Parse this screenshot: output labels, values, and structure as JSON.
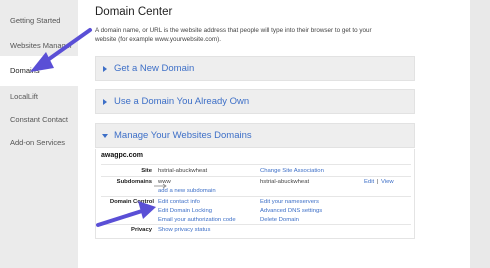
{
  "sidebar": {
    "items": [
      {
        "label": "Getting Started"
      },
      {
        "label": "Websites Manager"
      },
      {
        "label": "Domains"
      },
      {
        "label": "LocalLift"
      },
      {
        "label": "Constant Contact"
      },
      {
        "label": "Add-on Services"
      }
    ]
  },
  "main": {
    "title": "Domain Center",
    "intro": "A domain name, or URL is the website address that people will type into their browser to get to your website (for example www.yourwebsite.com).",
    "accordions": [
      {
        "label": "Get a New Domain"
      },
      {
        "label": "Use a Domain You Already Own"
      },
      {
        "label": "Manage Your Websites Domains"
      }
    ]
  },
  "domain": {
    "name": "awagpc.com",
    "site_label": "Site",
    "site_value": "hstrial-abuckwheat",
    "change_site": "Change Site Association",
    "subdomains_label": "Subdomains",
    "sub_www": "www",
    "sub_target": "hstrial-abuckwheat",
    "edit": "Edit",
    "sep": "|",
    "view": "View",
    "add_subdomain": "add a new subdomain",
    "domain_control_label": "Domain Control",
    "edit_contact": "Edit contact info",
    "edit_nameservers": "Edit your nameservers",
    "edit_locking": "Edit Domain Locking",
    "advanced_dns": "Advanced DNS settings",
    "email_auth": "Email your authorization code",
    "delete_domain": "Delete Domain",
    "privacy_label": "Privacy",
    "show_privacy": "Show privacy status"
  },
  "colors": {
    "link": "#3d6fc7",
    "annotation_arrow": "#5a4fd6"
  }
}
